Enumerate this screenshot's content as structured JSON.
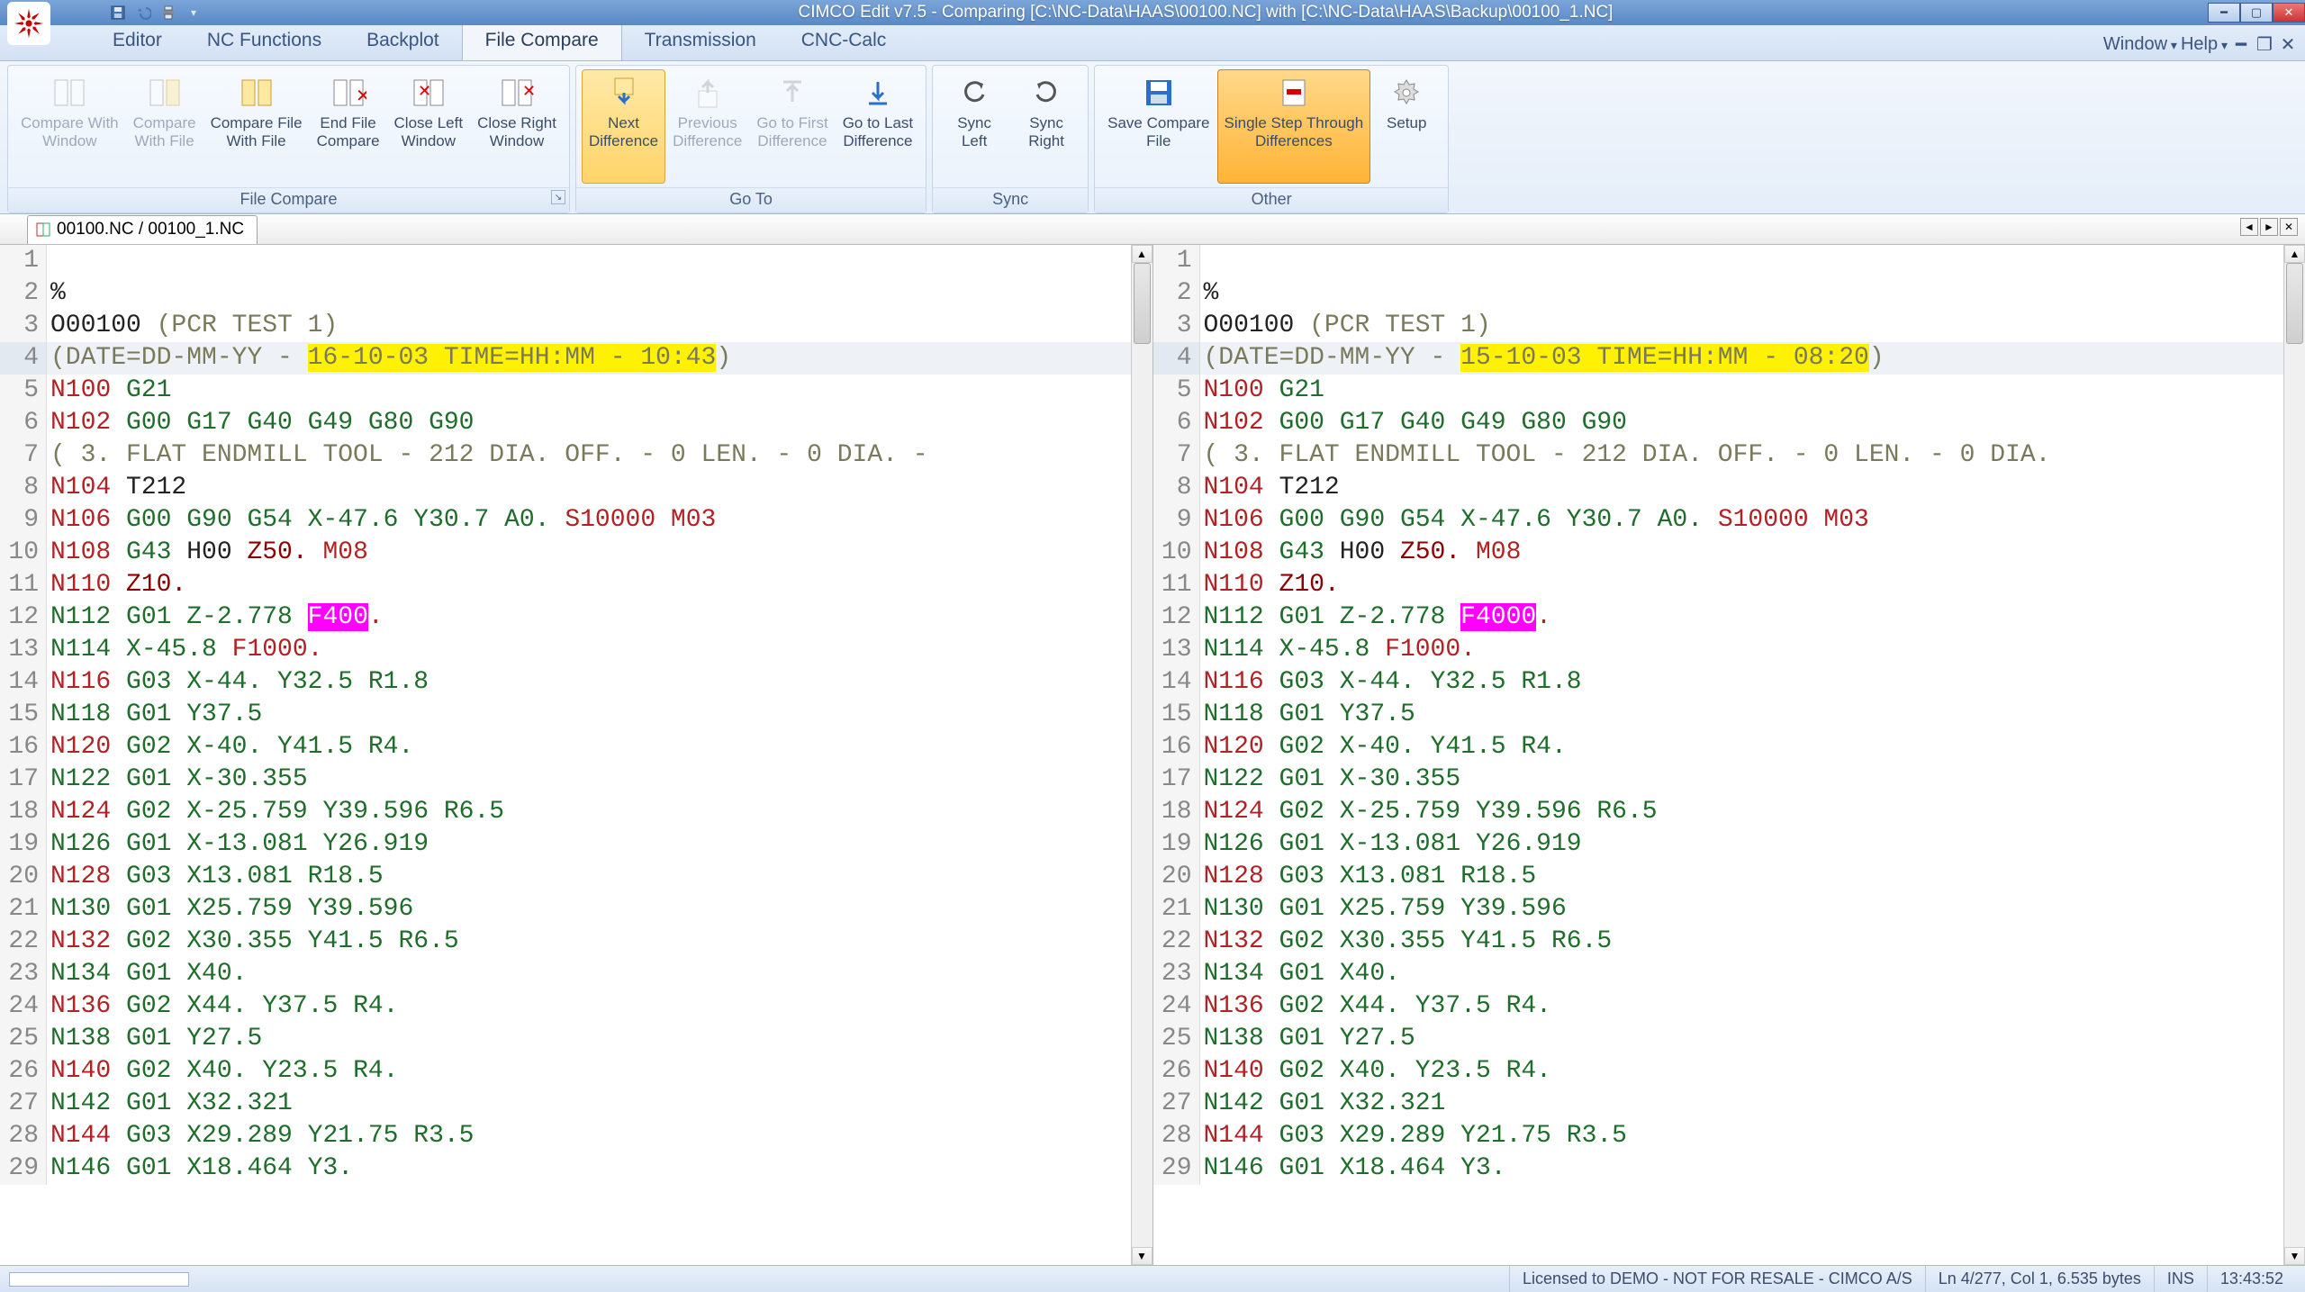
{
  "app": {
    "title": "CIMCO Edit v7.5 - Comparing [C:\\NC-Data\\HAAS\\00100.NC] with [C:\\NC-Data\\HAAS\\Backup\\00100_1.NC]"
  },
  "menu": {
    "tabs": [
      "Editor",
      "NC Functions",
      "Backplot",
      "File Compare",
      "Transmission",
      "CNC-Calc"
    ],
    "active": "File Compare",
    "right": {
      "window": "Window",
      "help": "Help"
    }
  },
  "ribbon": {
    "groups": [
      {
        "label": "File Compare",
        "buttons": [
          {
            "key": "cmpwin",
            "l1": "Compare With",
            "l2": "Window",
            "enabled": false
          },
          {
            "key": "cmpfile",
            "l1": "Compare",
            "l2": "With File",
            "enabled": false
          },
          {
            "key": "cmpfilewf",
            "l1": "Compare File",
            "l2": "With File",
            "enabled": true
          },
          {
            "key": "endcmp",
            "l1": "End File",
            "l2": "Compare",
            "enabled": true
          },
          {
            "key": "closel",
            "l1": "Close Left",
            "l2": "Window",
            "enabled": true
          },
          {
            "key": "closer",
            "l1": "Close Right",
            "l2": "Window",
            "enabled": true
          }
        ]
      },
      {
        "label": "Go To",
        "buttons": [
          {
            "key": "next",
            "l1": "Next",
            "l2": "Difference",
            "enabled": true,
            "hover": true
          },
          {
            "key": "prev",
            "l1": "Previous",
            "l2": "Difference",
            "enabled": false
          },
          {
            "key": "first",
            "l1": "Go to First",
            "l2": "Difference",
            "enabled": false
          },
          {
            "key": "last",
            "l1": "Go to Last",
            "l2": "Difference",
            "enabled": true
          }
        ]
      },
      {
        "label": "Sync",
        "buttons": [
          {
            "key": "syncl",
            "l1": "Sync",
            "l2": "Left",
            "enabled": true
          },
          {
            "key": "syncr",
            "l1": "Sync",
            "l2": "Right",
            "enabled": true
          }
        ]
      },
      {
        "label": "Other",
        "buttons": [
          {
            "key": "savecmp",
            "l1": "Save Compare",
            "l2": "File",
            "enabled": true
          },
          {
            "key": "step",
            "l1": "Single Step Through",
            "l2": "Differences",
            "enabled": true,
            "active": true
          },
          {
            "key": "setup",
            "l1": "Setup",
            "l2": "",
            "enabled": true
          }
        ]
      }
    ]
  },
  "doctab": {
    "label": "00100.NC / 00100_1.NC"
  },
  "left": {
    "lines": [
      {
        "n": 1,
        "segs": []
      },
      {
        "n": 2,
        "segs": [
          {
            "t": "%",
            "c": "blk"
          }
        ]
      },
      {
        "n": 3,
        "segs": [
          {
            "t": "O00100 ",
            "c": "blk"
          },
          {
            "t": "(PCR TEST 1)",
            "c": "cmt"
          }
        ]
      },
      {
        "n": 4,
        "current": true,
        "segs": [
          {
            "t": "(DATE=DD-MM-YY - ",
            "c": "cmt"
          },
          {
            "t": "16-10-03 TIME=HH:MM - 10:43",
            "c": "cmt",
            "hl": "y"
          },
          {
            "t": ")",
            "c": "cmt"
          }
        ]
      },
      {
        "n": 5,
        "segs": [
          {
            "t": "N100 ",
            "c": "n"
          },
          {
            "t": "G21",
            "c": "g"
          }
        ]
      },
      {
        "n": 6,
        "segs": [
          {
            "t": "N102 ",
            "c": "n"
          },
          {
            "t": "G00 G17 G40 G49 G80 G90",
            "c": "g"
          }
        ]
      },
      {
        "n": 7,
        "segs": [
          {
            "t": "( 3. FLAT ENDMILL TOOL - 212 DIA. OFF. - 0 LEN. - 0 DIA. -",
            "c": "cmt"
          }
        ]
      },
      {
        "n": 8,
        "segs": [
          {
            "t": "N104 ",
            "c": "n"
          },
          {
            "t": "T212",
            "c": "blk"
          }
        ]
      },
      {
        "n": 9,
        "segs": [
          {
            "t": "N106 ",
            "c": "n"
          },
          {
            "t": "G00 G90 G54 ",
            "c": "g"
          },
          {
            "t": "X-47.6 Y30.7 A0. ",
            "c": "grn"
          },
          {
            "t": "S10000 M03",
            "c": "n"
          }
        ]
      },
      {
        "n": 10,
        "segs": [
          {
            "t": "N108 ",
            "c": "n"
          },
          {
            "t": "G43 ",
            "c": "g"
          },
          {
            "t": "H00 ",
            "c": "blk"
          },
          {
            "t": "Z50. ",
            "c": "z"
          },
          {
            "t": "M08",
            "c": "n"
          }
        ]
      },
      {
        "n": 11,
        "segs": [
          {
            "t": "N110 ",
            "c": "n"
          },
          {
            "t": "Z10.",
            "c": "z"
          }
        ]
      },
      {
        "n": 12,
        "segs": [
          {
            "t": "N112 ",
            "c": "grn"
          },
          {
            "t": "G01 ",
            "c": "grn"
          },
          {
            "t": "Z-2.778 ",
            "c": "grn"
          },
          {
            "t": "F400",
            "c": "blk",
            "hl": "m"
          },
          {
            "t": ".",
            "c": "n"
          }
        ]
      },
      {
        "n": 13,
        "segs": [
          {
            "t": "N114 ",
            "c": "grn"
          },
          {
            "t": "X-45.8 ",
            "c": "grn"
          },
          {
            "t": "F1000.",
            "c": "n"
          }
        ]
      },
      {
        "n": 14,
        "segs": [
          {
            "t": "N116 ",
            "c": "n"
          },
          {
            "t": "G03 ",
            "c": "g"
          },
          {
            "t": "X-44. Y32.5 R1.8",
            "c": "grn"
          }
        ]
      },
      {
        "n": 15,
        "segs": [
          {
            "t": "N118 ",
            "c": "grn"
          },
          {
            "t": "G01 ",
            "c": "grn"
          },
          {
            "t": "Y37.5",
            "c": "grn"
          }
        ]
      },
      {
        "n": 16,
        "segs": [
          {
            "t": "N120 ",
            "c": "n"
          },
          {
            "t": "G02 ",
            "c": "g"
          },
          {
            "t": "X-40. Y41.5 R4.",
            "c": "grn"
          }
        ]
      },
      {
        "n": 17,
        "segs": [
          {
            "t": "N122 ",
            "c": "grn"
          },
          {
            "t": "G01 ",
            "c": "grn"
          },
          {
            "t": "X-30.355",
            "c": "grn"
          }
        ]
      },
      {
        "n": 18,
        "segs": [
          {
            "t": "N124 ",
            "c": "n"
          },
          {
            "t": "G02 ",
            "c": "g"
          },
          {
            "t": "X-25.759 Y39.596 R6.5",
            "c": "grn"
          }
        ]
      },
      {
        "n": 19,
        "segs": [
          {
            "t": "N126 ",
            "c": "grn"
          },
          {
            "t": "G01 ",
            "c": "grn"
          },
          {
            "t": "X-13.081 Y26.919",
            "c": "grn"
          }
        ]
      },
      {
        "n": 20,
        "segs": [
          {
            "t": "N128 ",
            "c": "n"
          },
          {
            "t": "G03 ",
            "c": "g"
          },
          {
            "t": "X13.081 R18.5",
            "c": "grn"
          }
        ]
      },
      {
        "n": 21,
        "segs": [
          {
            "t": "N130 ",
            "c": "grn"
          },
          {
            "t": "G01 ",
            "c": "grn"
          },
          {
            "t": "X25.759 Y39.596",
            "c": "grn"
          }
        ]
      },
      {
        "n": 22,
        "segs": [
          {
            "t": "N132 ",
            "c": "n"
          },
          {
            "t": "G02 ",
            "c": "g"
          },
          {
            "t": "X30.355 Y41.5 R6.5",
            "c": "grn"
          }
        ]
      },
      {
        "n": 23,
        "segs": [
          {
            "t": "N134 ",
            "c": "grn"
          },
          {
            "t": "G01 ",
            "c": "grn"
          },
          {
            "t": "X40.",
            "c": "grn"
          }
        ]
      },
      {
        "n": 24,
        "segs": [
          {
            "t": "N136 ",
            "c": "n"
          },
          {
            "t": "G02 ",
            "c": "g"
          },
          {
            "t": "X44. Y37.5 R4.",
            "c": "grn"
          }
        ]
      },
      {
        "n": 25,
        "segs": [
          {
            "t": "N138 ",
            "c": "grn"
          },
          {
            "t": "G01 ",
            "c": "grn"
          },
          {
            "t": "Y27.5",
            "c": "grn"
          }
        ]
      },
      {
        "n": 26,
        "segs": [
          {
            "t": "N140 ",
            "c": "n"
          },
          {
            "t": "G02 ",
            "c": "g"
          },
          {
            "t": "X40. Y23.5 R4.",
            "c": "grn"
          }
        ]
      },
      {
        "n": 27,
        "segs": [
          {
            "t": "N142 ",
            "c": "grn"
          },
          {
            "t": "G01 ",
            "c": "grn"
          },
          {
            "t": "X32.321",
            "c": "grn"
          }
        ]
      },
      {
        "n": 28,
        "segs": [
          {
            "t": "N144 ",
            "c": "n"
          },
          {
            "t": "G03 ",
            "c": "g"
          },
          {
            "t": "X29.289 Y21.75 R3.5",
            "c": "grn"
          }
        ]
      },
      {
        "n": 29,
        "segs": [
          {
            "t": "N146 ",
            "c": "grn"
          },
          {
            "t": "G01 ",
            "c": "grn"
          },
          {
            "t": "X18.464 Y3.",
            "c": "grn"
          }
        ]
      }
    ]
  },
  "right": {
    "lines": [
      {
        "n": 1,
        "segs": []
      },
      {
        "n": 2,
        "segs": [
          {
            "t": "%",
            "c": "blk"
          }
        ]
      },
      {
        "n": 3,
        "segs": [
          {
            "t": "O00100 ",
            "c": "blk"
          },
          {
            "t": "(PCR TEST 1)",
            "c": "cmt"
          }
        ]
      },
      {
        "n": 4,
        "current": true,
        "segs": [
          {
            "t": "(DATE=DD-MM-YY - ",
            "c": "cmt"
          },
          {
            "t": "15-10-03 TIME=HH:MM - 08:20",
            "c": "cmt",
            "hl": "y"
          },
          {
            "t": ")",
            "c": "cmt"
          }
        ]
      },
      {
        "n": 5,
        "segs": [
          {
            "t": "N100 ",
            "c": "n"
          },
          {
            "t": "G21",
            "c": "g"
          }
        ]
      },
      {
        "n": 6,
        "segs": [
          {
            "t": "N102 ",
            "c": "n"
          },
          {
            "t": "G00 G17 G40 G49 G80 G90",
            "c": "g"
          }
        ]
      },
      {
        "n": 7,
        "segs": [
          {
            "t": "( 3. FLAT ENDMILL TOOL - 212 DIA. OFF. - 0 LEN. - 0 DIA.",
            "c": "cmt"
          }
        ]
      },
      {
        "n": 8,
        "segs": [
          {
            "t": "N104 ",
            "c": "n"
          },
          {
            "t": "T212",
            "c": "blk"
          }
        ]
      },
      {
        "n": 9,
        "segs": [
          {
            "t": "N106 ",
            "c": "n"
          },
          {
            "t": "G00 G90 G54 ",
            "c": "g"
          },
          {
            "t": "X-47.6 Y30.7 A0. ",
            "c": "grn"
          },
          {
            "t": "S10000 M03",
            "c": "n"
          }
        ]
      },
      {
        "n": 10,
        "segs": [
          {
            "t": "N108 ",
            "c": "n"
          },
          {
            "t": "G43 ",
            "c": "g"
          },
          {
            "t": "H00 ",
            "c": "blk"
          },
          {
            "t": "Z50. ",
            "c": "z"
          },
          {
            "t": "M08",
            "c": "n"
          }
        ]
      },
      {
        "n": 11,
        "segs": [
          {
            "t": "N110 ",
            "c": "n"
          },
          {
            "t": "Z10.",
            "c": "z"
          }
        ]
      },
      {
        "n": 12,
        "segs": [
          {
            "t": "N112 ",
            "c": "grn"
          },
          {
            "t": "G01 ",
            "c": "grn"
          },
          {
            "t": "Z-2.778 ",
            "c": "grn"
          },
          {
            "t": "F4000",
            "c": "blk",
            "hl": "m"
          },
          {
            "t": ".",
            "c": "n"
          }
        ]
      },
      {
        "n": 13,
        "segs": [
          {
            "t": "N114 ",
            "c": "grn"
          },
          {
            "t": "X-45.8 ",
            "c": "grn"
          },
          {
            "t": "F1000.",
            "c": "n"
          }
        ]
      },
      {
        "n": 14,
        "segs": [
          {
            "t": "N116 ",
            "c": "n"
          },
          {
            "t": "G03 ",
            "c": "g"
          },
          {
            "t": "X-44. Y32.5 R1.8",
            "c": "grn"
          }
        ]
      },
      {
        "n": 15,
        "segs": [
          {
            "t": "N118 ",
            "c": "grn"
          },
          {
            "t": "G01 ",
            "c": "grn"
          },
          {
            "t": "Y37.5",
            "c": "grn"
          }
        ]
      },
      {
        "n": 16,
        "segs": [
          {
            "t": "N120 ",
            "c": "n"
          },
          {
            "t": "G02 ",
            "c": "g"
          },
          {
            "t": "X-40. Y41.5 R4.",
            "c": "grn"
          }
        ]
      },
      {
        "n": 17,
        "segs": [
          {
            "t": "N122 ",
            "c": "grn"
          },
          {
            "t": "G01 ",
            "c": "grn"
          },
          {
            "t": "X-30.355",
            "c": "grn"
          }
        ]
      },
      {
        "n": 18,
        "segs": [
          {
            "t": "N124 ",
            "c": "n"
          },
          {
            "t": "G02 ",
            "c": "g"
          },
          {
            "t": "X-25.759 Y39.596 R6.5",
            "c": "grn"
          }
        ]
      },
      {
        "n": 19,
        "segs": [
          {
            "t": "N126 ",
            "c": "grn"
          },
          {
            "t": "G01 ",
            "c": "grn"
          },
          {
            "t": "X-13.081 Y26.919",
            "c": "grn"
          }
        ]
      },
      {
        "n": 20,
        "segs": [
          {
            "t": "N128 ",
            "c": "n"
          },
          {
            "t": "G03 ",
            "c": "g"
          },
          {
            "t": "X13.081 R18.5",
            "c": "grn"
          }
        ]
      },
      {
        "n": 21,
        "segs": [
          {
            "t": "N130 ",
            "c": "grn"
          },
          {
            "t": "G01 ",
            "c": "grn"
          },
          {
            "t": "X25.759 Y39.596",
            "c": "grn"
          }
        ]
      },
      {
        "n": 22,
        "segs": [
          {
            "t": "N132 ",
            "c": "n"
          },
          {
            "t": "G02 ",
            "c": "g"
          },
          {
            "t": "X30.355 Y41.5 R6.5",
            "c": "grn"
          }
        ]
      },
      {
        "n": 23,
        "segs": [
          {
            "t": "N134 ",
            "c": "grn"
          },
          {
            "t": "G01 ",
            "c": "grn"
          },
          {
            "t": "X40.",
            "c": "grn"
          }
        ]
      },
      {
        "n": 24,
        "segs": [
          {
            "t": "N136 ",
            "c": "n"
          },
          {
            "t": "G02 ",
            "c": "g"
          },
          {
            "t": "X44. Y37.5 R4.",
            "c": "grn"
          }
        ]
      },
      {
        "n": 25,
        "segs": [
          {
            "t": "N138 ",
            "c": "grn"
          },
          {
            "t": "G01 ",
            "c": "grn"
          },
          {
            "t": "Y27.5",
            "c": "grn"
          }
        ]
      },
      {
        "n": 26,
        "segs": [
          {
            "t": "N140 ",
            "c": "n"
          },
          {
            "t": "G02 ",
            "c": "g"
          },
          {
            "t": "X40. Y23.5 R4.",
            "c": "grn"
          }
        ]
      },
      {
        "n": 27,
        "segs": [
          {
            "t": "N142 ",
            "c": "grn"
          },
          {
            "t": "G01 ",
            "c": "grn"
          },
          {
            "t": "X32.321",
            "c": "grn"
          }
        ]
      },
      {
        "n": 28,
        "segs": [
          {
            "t": "N144 ",
            "c": "n"
          },
          {
            "t": "G03 ",
            "c": "g"
          },
          {
            "t": "X29.289 Y21.75 R3.5",
            "c": "grn"
          }
        ]
      },
      {
        "n": 29,
        "segs": [
          {
            "t": "N146 ",
            "c": "grn"
          },
          {
            "t": "G01 ",
            "c": "grn"
          },
          {
            "t": "X18.464 Y3.",
            "c": "grn"
          }
        ]
      }
    ]
  },
  "status": {
    "license": "Licensed to DEMO - NOT FOR RESALE - CIMCO A/S",
    "pos": "Ln 4/277, Col 1, 6.535 bytes",
    "ins": "INS",
    "time": "13:43:52"
  }
}
